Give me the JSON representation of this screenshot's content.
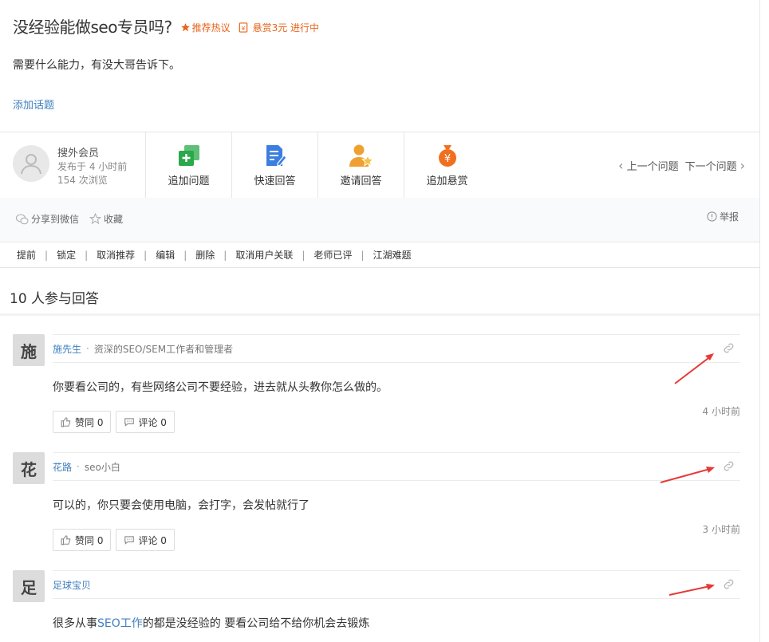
{
  "question": {
    "title": "没经验能做seo专员吗?",
    "badge_hot": "推荐热议",
    "badge_bounty": "悬赏3元 进行中",
    "description": "需要什么能力，有没大哥告诉下。",
    "add_topic": "添加话题"
  },
  "author": {
    "name": "搜外会员",
    "posted": "发布于 4 小时前",
    "views": "154 次浏览"
  },
  "actions": [
    {
      "label": "追加问题",
      "icon": "add-copy-icon",
      "color": "#2aa84a"
    },
    {
      "label": "快速回答",
      "icon": "edit-document-icon",
      "color": "#3b7ee0"
    },
    {
      "label": "邀请回答",
      "icon": "invite-user-icon",
      "color": "#f0a030"
    },
    {
      "label": "追加悬赏",
      "icon": "money-bag-icon",
      "color": "#f07020"
    }
  ],
  "nav": {
    "prev": "上一个问题",
    "next": "下一个问题"
  },
  "share": {
    "wechat": "分享到微信",
    "favorite": "收藏",
    "report": "举报"
  },
  "admin": [
    "提前",
    "锁定",
    "取消推荐",
    "编辑",
    "删除",
    "取消用户关联",
    "老师已评",
    "江湖难题"
  ],
  "answers_count": "10 人参与回答",
  "answers": [
    {
      "avatar": "施",
      "name": "施先生",
      "signature": "资深的SEO/SEM工作者和管理者",
      "content": "你要看公司的，有些网络公司不要经验，进去就从头教你怎么做的。",
      "time": "4 小时前",
      "likes": "赞同 0",
      "comments": "评论 0"
    },
    {
      "avatar": "花",
      "name": "花路",
      "signature": "seo小白",
      "content": "可以的，你只要会使用电脑，会打字，会发帖就行了",
      "time": "3 小时前",
      "likes": "赞同 0",
      "comments": "评论 0"
    },
    {
      "avatar": "足",
      "name": "足球宝贝",
      "signature": "",
      "content_pre": "很多从事",
      "content_link": "SEO工作",
      "content_post": "的都是没经验的  要看公司给不给你机会去锻炼"
    }
  ],
  "colors": {
    "link": "#3f7fbf",
    "accent": "#e8641b",
    "arrow": "#e53935"
  }
}
